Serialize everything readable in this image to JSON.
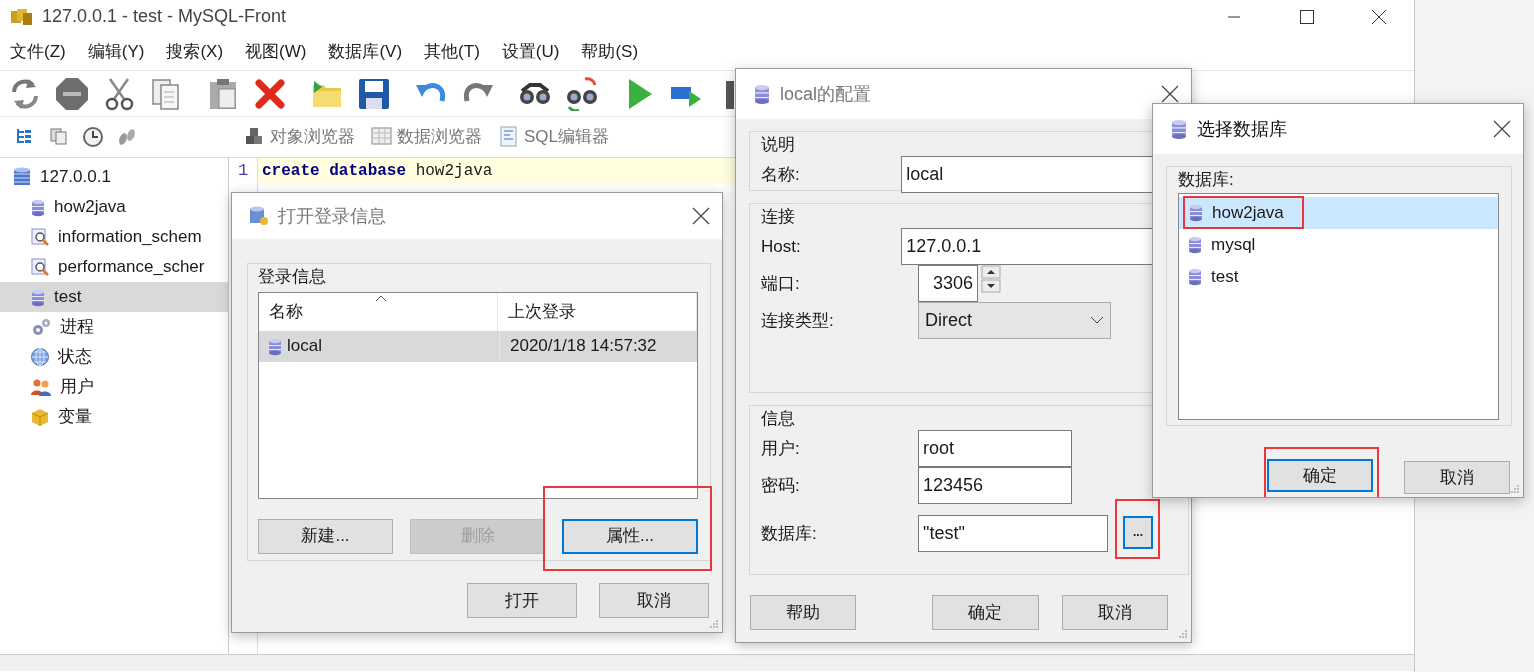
{
  "window": {
    "title": "127.0.0.1 - test - MySQL-Front"
  },
  "menu": [
    {
      "label": "文件(Z)"
    },
    {
      "label": "编辑(Y)"
    },
    {
      "label": "搜索(X)"
    },
    {
      "label": "视图(W)"
    },
    {
      "label": "数据库(V)"
    },
    {
      "label": "其他(T)"
    },
    {
      "label": "设置(U)"
    },
    {
      "label": "帮助(S)"
    }
  ],
  "view_buttons": [
    {
      "label": "对象浏览器",
      "kind": "objects"
    },
    {
      "label": "数据浏览器",
      "kind": "data"
    },
    {
      "label": "SQL编辑器",
      "kind": "sql"
    }
  ],
  "tree": {
    "label": "127.0.0.1",
    "kind": "server",
    "selected": false,
    "children": [
      {
        "label": "how2java",
        "kind": "database",
        "selected": false
      },
      {
        "label": "information_schem",
        "kind": "schema",
        "selected": false
      },
      {
        "label": "performance_scher",
        "kind": "schema",
        "selected": false
      },
      {
        "label": "test",
        "kind": "database",
        "selected": true
      },
      {
        "label": "进程",
        "kind": "processes",
        "selected": false
      },
      {
        "label": "状态",
        "kind": "status",
        "selected": false
      },
      {
        "label": "用户",
        "kind": "users",
        "selected": false
      },
      {
        "label": "变量",
        "kind": "variables",
        "selected": false
      }
    ]
  },
  "editor": {
    "lines": [
      {
        "number": "1",
        "code": "**create** **database** how2java",
        "current": true
      }
    ]
  },
  "login_dialog": {
    "title": "打开登录信息",
    "group": "登录信息",
    "columns": [
      {
        "label": "名称",
        "sorted": true
      },
      {
        "label": "上次登录",
        "sorted": false
      }
    ],
    "rows": [
      {
        "name": "local",
        "last_login": "2020/1/18 14:57:32",
        "selected": true
      }
    ],
    "buttons": [
      {
        "label": "新建...",
        "disabled": false,
        "focused": false,
        "highlighted": false
      },
      {
        "label": "删除",
        "disabled": true,
        "focused": false,
        "highlighted": false
      },
      {
        "label": "属性...",
        "disabled": false,
        "focused": true,
        "highlighted": true
      }
    ],
    "footer_buttons": [
      {
        "label": "打开"
      },
      {
        "label": "取消"
      }
    ]
  },
  "config_dialog": {
    "title": "local的配置",
    "groups": [
      {
        "title": "说明",
        "fields": [
          {
            "label": "名称:",
            "value": "local",
            "kind": "text"
          }
        ]
      },
      {
        "title": "连接",
        "fields": [
          {
            "label": "Host:",
            "value": "127.0.0.1",
            "kind": "text"
          },
          {
            "label": "端口:",
            "value": "3306",
            "kind": "spin"
          },
          {
            "label": "连接类型:",
            "value": "Direct",
            "kind": "select"
          }
        ]
      },
      {
        "title": "信息",
        "fields": [
          {
            "label": "用户:",
            "value": "root",
            "kind": "text"
          },
          {
            "label": "密码:",
            "value": "123456",
            "kind": "text"
          },
          {
            "label": "数据库:",
            "value": "\"test\"",
            "kind": "browse",
            "button": "...",
            "highlighted": true
          }
        ]
      }
    ],
    "buttons": [
      {
        "label": "帮助"
      },
      {
        "label": "确定"
      },
      {
        "label": "取消"
      }
    ]
  },
  "select_dialog": {
    "title": "选择数据库",
    "label": "数据库:",
    "items": [
      {
        "label": "how2java",
        "selected": true,
        "highlighted": true
      },
      {
        "label": "mysql",
        "selected": false,
        "highlighted": false
      },
      {
        "label": "test",
        "selected": false,
        "highlighted": false
      }
    ],
    "buttons": [
      {
        "label": "确定",
        "focused": true,
        "highlighted": true
      },
      {
        "label": "取消",
        "focused": false,
        "highlighted": false
      }
    ]
  }
}
